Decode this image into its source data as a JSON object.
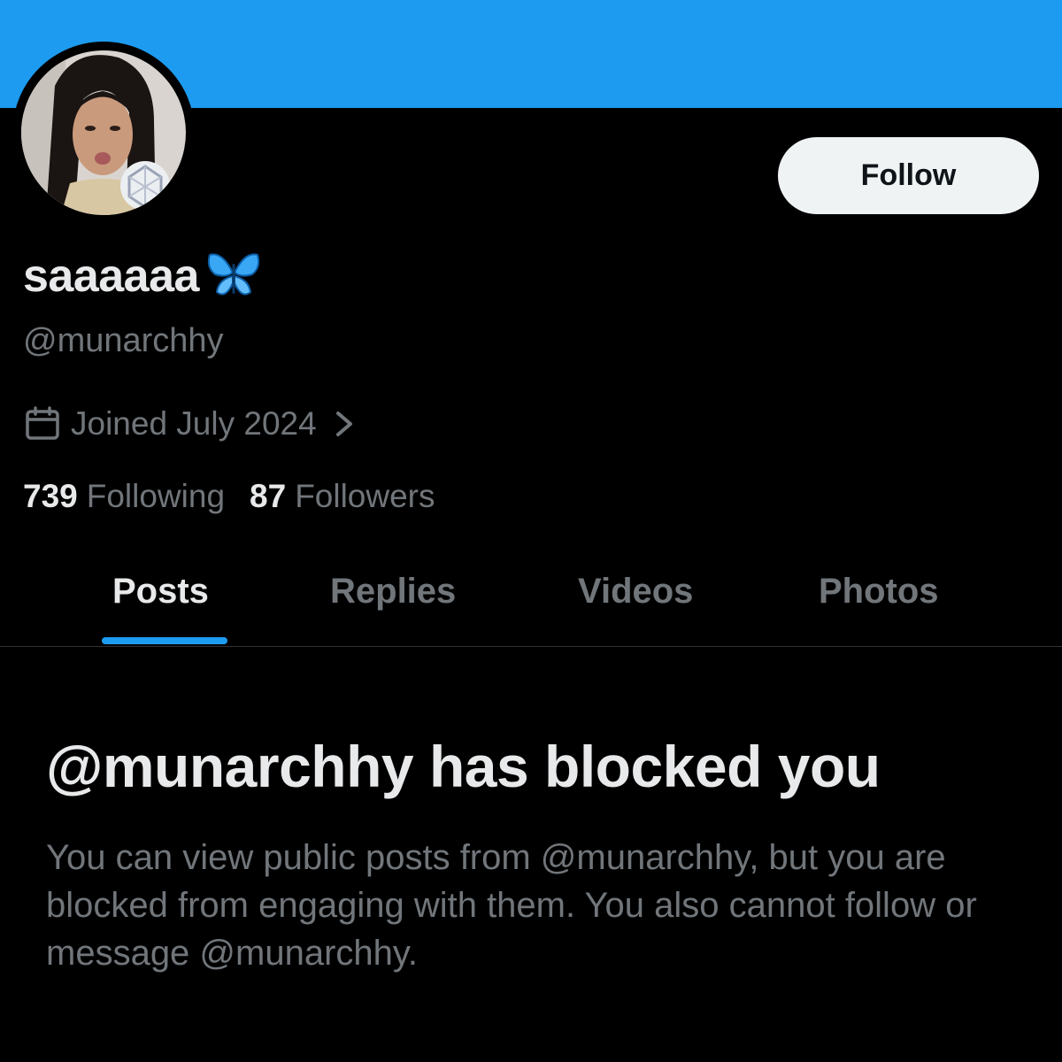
{
  "profile": {
    "display_name": "saaaaaa",
    "name_emoji": "butterfly-emoji",
    "handle": "@munarchhy",
    "joined": "Joined July 2024",
    "following_count": "739",
    "following_label": "Following",
    "followers_count": "87",
    "followers_label": "Followers"
  },
  "actions": {
    "follow_label": "Follow"
  },
  "tabs": [
    {
      "label": "Posts",
      "active": true
    },
    {
      "label": "Replies",
      "active": false
    },
    {
      "label": "Videos",
      "active": false
    },
    {
      "label": "Photos",
      "active": false
    }
  ],
  "blocked": {
    "title": "@munarchhy has blocked you",
    "message": "You can view public posts from @munarchhy, but you are blocked from engaging with them. You also cannot follow or message @munarchhy."
  },
  "colors": {
    "banner": "#1d9bf0",
    "accent": "#1d9bf0",
    "background": "#000000",
    "primary_text": "#e7e9ea",
    "secondary_text": "#71767b"
  },
  "icons": [
    "calendar-icon",
    "chevron-right-icon",
    "butterfly-emoji",
    "profile-avatar"
  ]
}
